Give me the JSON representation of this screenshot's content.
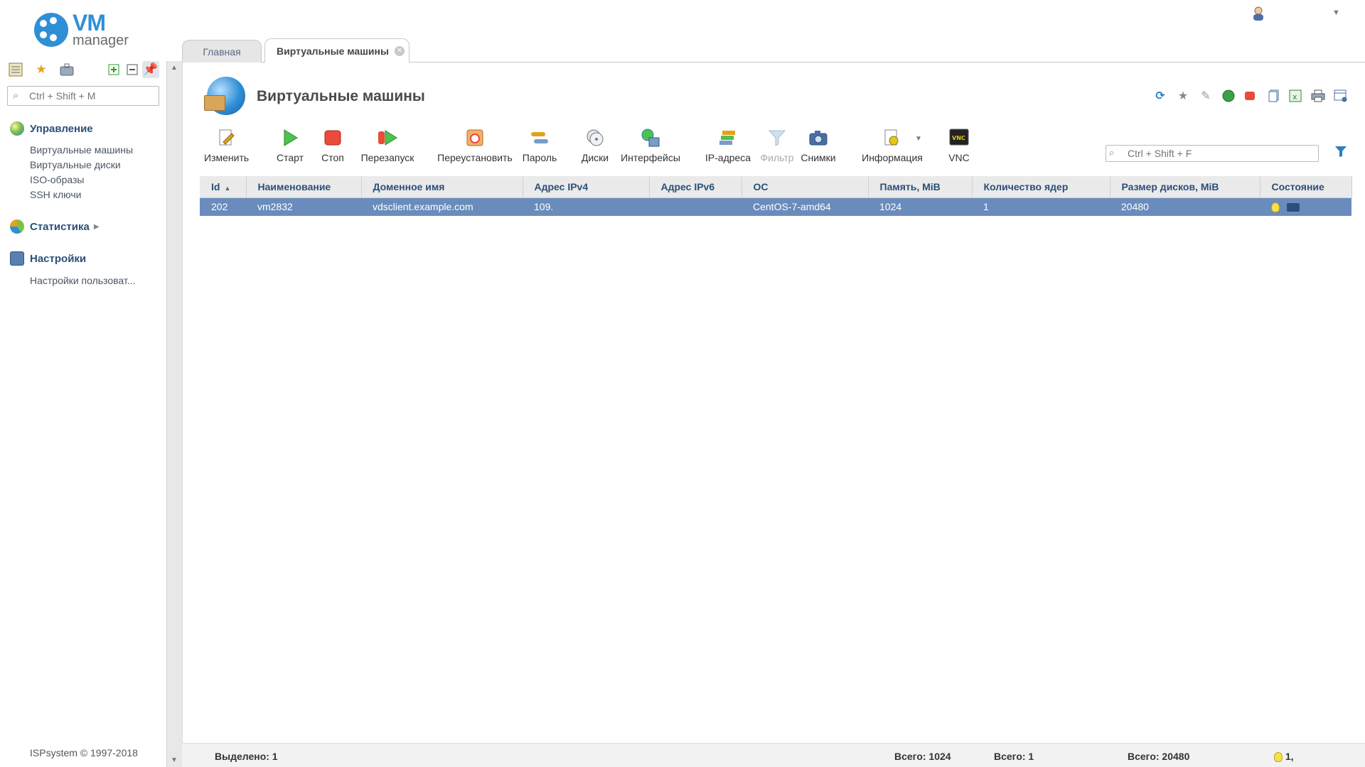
{
  "app": {
    "logo_main": "VM",
    "logo_sub": "manager",
    "brand_color": "#2f8fd6"
  },
  "sidebar": {
    "search_placeholder": "Ctrl + Shift + M",
    "tools": [
      "list-view-icon",
      "favorites-star-icon",
      "briefcase-icon",
      "expand-all-icon",
      "collapse-all-icon",
      "pin-icon"
    ],
    "groups": [
      {
        "title": "Управление",
        "icon": "globe-icon",
        "items": [
          "Виртуальные машины",
          "Виртуальные диски",
          "ISO-образы",
          "SSH ключи"
        ]
      },
      {
        "title": "Статистика",
        "icon": "pie-chart-icon",
        "items": []
      },
      {
        "title": "Настройки",
        "icon": "monitor-settings-icon",
        "items": [
          "Настройки пользоват..."
        ]
      }
    ],
    "copyright": "ISPsystem © 1997-2018"
  },
  "tabs": [
    {
      "label": "Главная",
      "active": false
    },
    {
      "label": "Виртуальные машины",
      "active": true
    }
  ],
  "page": {
    "title": "Виртуальные машины"
  },
  "toolbar": [
    {
      "label": "Изменить",
      "icon": "edit-icon"
    },
    {
      "label": "Старт",
      "icon": "play-icon"
    },
    {
      "label": "Стоп",
      "icon": "stop-icon"
    },
    {
      "label": "Перезапуск",
      "icon": "restart-icon"
    },
    {
      "label": "Переустановить",
      "icon": "reinstall-icon"
    },
    {
      "label": "Пароль",
      "icon": "password-icon"
    },
    {
      "label": "Диски",
      "icon": "disks-icon"
    },
    {
      "label": "Интерфейсы",
      "icon": "interfaces-icon"
    },
    {
      "label": "IP-адреса",
      "icon": "ip-addresses-icon"
    },
    {
      "label": "Фильтр",
      "icon": "filter-funnel-icon",
      "disabled": true
    },
    {
      "label": "Снимки",
      "icon": "camera-icon"
    },
    {
      "label": "Информация",
      "icon": "info-icon"
    },
    {
      "label": "VNC",
      "icon": "vnc-icon"
    }
  ],
  "table_search_placeholder": "Ctrl + Shift + F",
  "table": {
    "columns": [
      "Id",
      "Наименование",
      "Доменное имя",
      "Адрес IPv4",
      "Адрес IPv6",
      "ОС",
      "Память, MiB",
      "Количество ядер",
      "Размер дисков, MiB",
      "Состояние"
    ],
    "rows": [
      {
        "id": "202",
        "name": "vm2832",
        "domain": "vdsclient.example.com",
        "ipv4": "109.",
        "ipv6": "",
        "os": "CentOS-7-amd64",
        "mem": "1024",
        "cores": "1",
        "disk": "20480"
      }
    ]
  },
  "footer": {
    "selected": "Выделено: 1",
    "mem_total": "Всего: 1024",
    "cores_total": "Всего: 1",
    "disk_total": "Всего: 20480",
    "state_count": "1,"
  }
}
